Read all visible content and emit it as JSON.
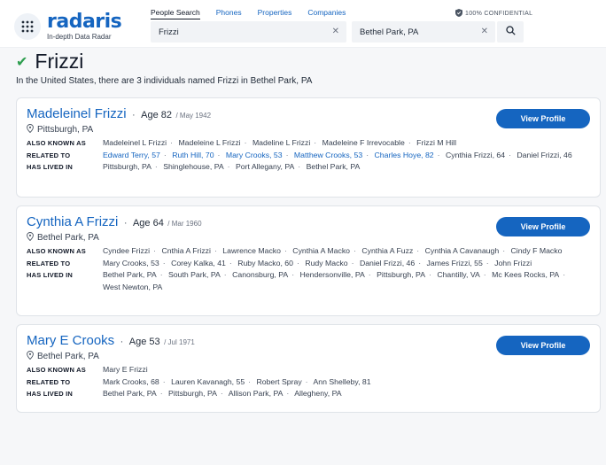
{
  "brand": {
    "name": "radaris",
    "tagline": "In-depth Data Radar"
  },
  "nav": [
    {
      "label": "People Search",
      "active": true
    },
    {
      "label": "Phones",
      "active": false
    },
    {
      "label": "Properties",
      "active": false
    },
    {
      "label": "Companies",
      "active": false
    }
  ],
  "confidential": "100% CONFIDENTIAL",
  "search": {
    "name_value": "Frizzi",
    "location_value": "Bethel Park, PA"
  },
  "page": {
    "title": "Frizzi",
    "summary": "In the United States, there are 3 individuals named Frizzi in Bethel Park, PA"
  },
  "labels": {
    "aka": "ALSO KNOWN AS",
    "related": "RELATED TO",
    "lived": "HAS LIVED IN",
    "view_profile": "View Profile"
  },
  "people": [
    {
      "name": "Madeleinel Frizzi",
      "age": "Age 82",
      "dob": "/ May 1942",
      "location": "Pittsburgh, PA",
      "aka": [
        "Madeleinel L Frizzi",
        "Madeleine L Frizzi",
        "Madeline L Frizzi",
        "Madeleine F Irrevocable",
        "Frizzi M Hill"
      ],
      "related": [
        {
          "text": "Edward Terry, 57",
          "link": true
        },
        {
          "text": "Ruth Hill, 70",
          "link": true
        },
        {
          "text": "Mary Crooks, 53",
          "link": true
        },
        {
          "text": "Matthew Crooks, 53",
          "link": true
        },
        {
          "text": "Charles Hoye, 82",
          "link": true
        },
        {
          "text": "Cynthia Frizzi, 64",
          "link": false
        },
        {
          "text": "Daniel Frizzi, 46",
          "link": false
        }
      ],
      "lived": [
        "Pittsburgh, PA",
        "Shinglehouse, PA",
        "Port Allegany, PA",
        "Bethel Park, PA"
      ]
    },
    {
      "name": "Cynthia A Frizzi",
      "age": "Age 64",
      "dob": "/ Mar 1960",
      "location": "Bethel Park, PA",
      "aka": [
        "Cyndee Frizzi",
        "Cnthia A Frizzi",
        "Lawrence Macko",
        "Cynthia A Macko",
        "Cynthia A Fuzz",
        "Cynthia A Cavanaugh",
        "Cindy F Macko"
      ],
      "related": [
        {
          "text": "Mary Crooks, 53",
          "link": false
        },
        {
          "text": "Corey Kalka, 41",
          "link": false
        },
        {
          "text": "Ruby Macko, 60",
          "link": false
        },
        {
          "text": "Rudy Macko",
          "link": false
        },
        {
          "text": "Daniel Frizzi, 46",
          "link": false
        },
        {
          "text": "James Frizzi, 55",
          "link": false
        },
        {
          "text": "John Frizzi",
          "link": false
        }
      ],
      "lived": [
        "Bethel Park, PA",
        "South Park, PA",
        "Canonsburg, PA",
        "Hendersonville, PA",
        "Pittsburgh, PA",
        "Chantilly, VA",
        "Mc Kees Rocks, PA",
        "West Newton, PA"
      ]
    },
    {
      "name": "Mary E Crooks",
      "age": "Age 53",
      "dob": "/ Jul 1971",
      "location": "Bethel Park, PA",
      "aka": [
        "Mary E Frizzi"
      ],
      "related": [
        {
          "text": "Mark Crooks, 68",
          "link": false
        },
        {
          "text": "Lauren Kavanagh, 55",
          "link": false
        },
        {
          "text": "Robert Spray",
          "link": false
        },
        {
          "text": "Ann Shelleby, 81",
          "link": false
        }
      ],
      "lived": [
        "Bethel Park, PA",
        "Pittsburgh, PA",
        "Allison Park, PA",
        "Allegheny, PA"
      ]
    }
  ]
}
